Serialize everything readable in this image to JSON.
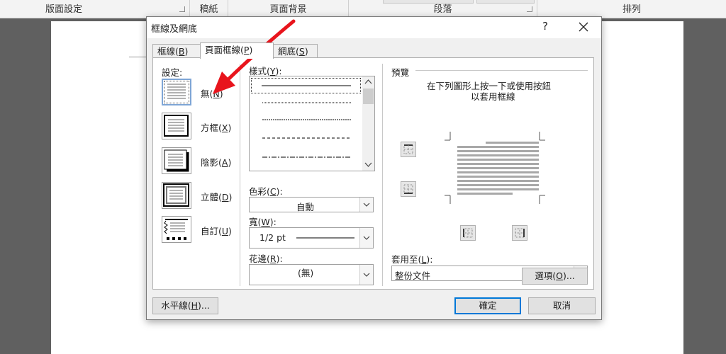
{
  "ribbon": {
    "groups": [
      {
        "label": "版面設定"
      },
      {
        "label": "稿紙"
      },
      {
        "label": "頁面背景"
      },
      {
        "label": "段落"
      },
      {
        "label": "排列"
      }
    ]
  },
  "dialog": {
    "title": "框線及網底",
    "help": "?",
    "tabs": [
      {
        "label": "框線(",
        "key": "B",
        "suffix": ")"
      },
      {
        "label": "頁面框線(",
        "key": "P",
        "suffix": ")"
      },
      {
        "label": "網底(",
        "key": "S",
        "suffix": ")"
      }
    ],
    "settings": {
      "header": "設定:",
      "items": [
        {
          "label": "無(",
          "key": "N",
          "suffix": ")"
        },
        {
          "label": "方框(",
          "key": "X",
          "suffix": ")"
        },
        {
          "label": "陰影(",
          "key": "A",
          "suffix": ")"
        },
        {
          "label": "立體(",
          "key": "D",
          "suffix": ")"
        },
        {
          "label": "自訂(",
          "key": "U",
          "suffix": ")"
        }
      ]
    },
    "style": {
      "label": "樣式(",
      "key": "Y",
      "suffix": "):"
    },
    "color": {
      "label": "色彩(",
      "key": "C",
      "suffix": "):",
      "value": "自動"
    },
    "width": {
      "label": "寬(",
      "key": "W",
      "suffix": "):",
      "value": "1/2 pt"
    },
    "art": {
      "label": "花邊(",
      "key": "R",
      "suffix": "):",
      "value": "(無)"
    },
    "preview": {
      "header": "預覽",
      "instruction_line1": "在下列圖形上按一下或使用按鈕",
      "instruction_line2": "以套用框線"
    },
    "apply_to": {
      "label": "套用至(",
      "key": "L",
      "suffix": "):",
      "value": "整份文件"
    },
    "buttons": {
      "options": {
        "label": "選項(",
        "key": "O",
        "suffix": ")..."
      },
      "horizontal_line": {
        "label": "水平線(",
        "key": "H",
        "suffix": ")..."
      },
      "ok": "確定",
      "cancel": "取消"
    }
  },
  "annotation": {
    "color": "#e8141c",
    "type": "red-arrow"
  }
}
